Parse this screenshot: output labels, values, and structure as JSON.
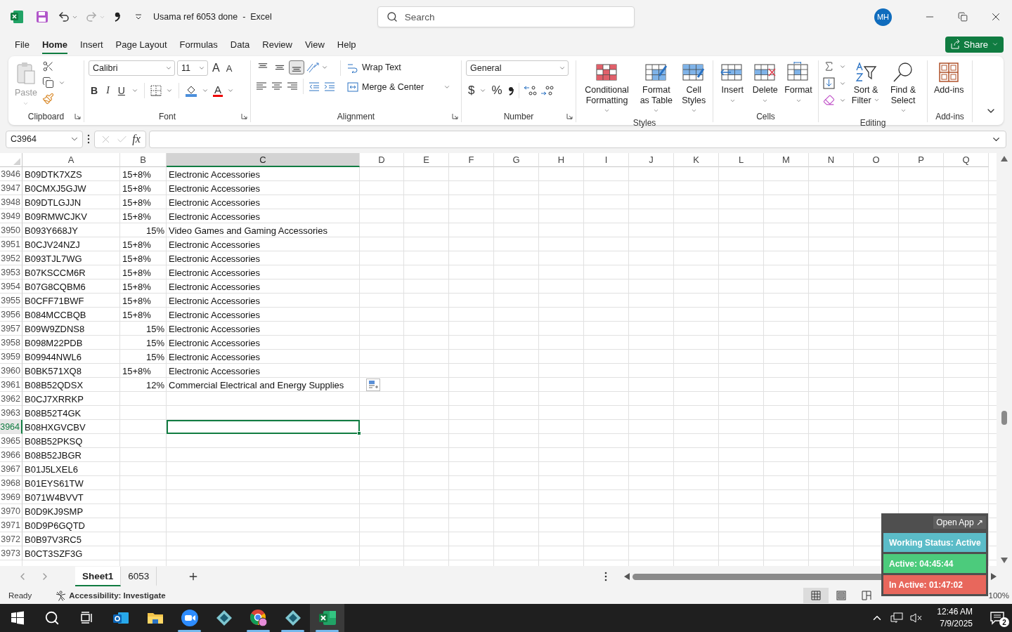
{
  "title_bar": {
    "document_title": "Usama ref 6053 done  -  Excel",
    "redo_disabled": true,
    "search_placeholder": "Search",
    "avatar": "MH"
  },
  "menu": {
    "tabs": [
      {
        "label": "File",
        "selected": false
      },
      {
        "label": "Home",
        "selected": true
      },
      {
        "label": "Insert",
        "selected": false
      },
      {
        "label": "Page Layout",
        "selected": false
      },
      {
        "label": "Formulas",
        "selected": false
      },
      {
        "label": "Data",
        "selected": false
      },
      {
        "label": "Review",
        "selected": false
      },
      {
        "label": "View",
        "selected": false
      },
      {
        "label": "Help",
        "selected": false
      }
    ],
    "share": "Share"
  },
  "ribbon": {
    "clipboard": {
      "label": "Clipboard",
      "paste": "Paste",
      "paste_disabled": true
    },
    "font": {
      "label": "Font",
      "name": "Calibri",
      "size": "11",
      "grow_button": "A",
      "shrink_button": "A",
      "bold": "B",
      "italic": "I",
      "underline": "U",
      "text_paint_button": "A"
    },
    "alignment": {
      "label": "Alignment",
      "vertical": [
        {
          "kind": "top",
          "selected": false
        },
        {
          "kind": "middle",
          "selected": false
        },
        {
          "kind": "bottom",
          "selected": true
        }
      ],
      "wrap": "Wrap Text",
      "merge": "Merge & Center"
    },
    "number": {
      "label": "Number",
      "format": "General",
      "currency": "$",
      "percent": "%"
    },
    "styles": {
      "label": "Styles",
      "buttons": [
        {
          "kind": "conditional",
          "label": "Conditional Formatting"
        },
        {
          "kind": "table",
          "label": "Format as Table"
        },
        {
          "kind": "cell",
          "label": "Cell Styles"
        }
      ]
    },
    "cells": {
      "label": "Cells",
      "buttons": [
        {
          "kind": "insert",
          "label": "Insert"
        },
        {
          "kind": "delete",
          "label": "Delete"
        },
        {
          "kind": "format",
          "label": "Format"
        }
      ]
    },
    "editing": {
      "label": "Editing",
      "sort": "Sort & Filter",
      "find": "Find & Select"
    },
    "addins": {
      "label": "Add-ins",
      "button": "Add-ins"
    }
  },
  "formula_bar": {
    "name_box": "C3964",
    "editing": false,
    "function_button": "fx"
  },
  "columns": [
    {
      "label": "A",
      "selected": false
    },
    {
      "label": "B",
      "selected": false
    },
    {
      "label": "C",
      "selected": true
    },
    {
      "label": "D",
      "selected": false
    },
    {
      "label": "E",
      "selected": false
    },
    {
      "label": "F",
      "selected": false
    },
    {
      "label": "G",
      "selected": false
    },
    {
      "label": "H",
      "selected": false
    },
    {
      "label": "I",
      "selected": false
    },
    {
      "label": "J",
      "selected": false
    },
    {
      "label": "K",
      "selected": false
    },
    {
      "label": "L",
      "selected": false
    },
    {
      "label": "M",
      "selected": false
    },
    {
      "label": "N",
      "selected": false
    },
    {
      "label": "O",
      "selected": false
    },
    {
      "label": "P",
      "selected": false
    },
    {
      "label": "Q",
      "selected": false
    }
  ],
  "rows": [
    {
      "number": "3946",
      "selected": false,
      "cells": [
        {
          "value": "B09DTK7XZS",
          "kind": "text"
        },
        {
          "value": "15+8%",
          "kind": "text"
        },
        {
          "value": "Electronic Accessories",
          "kind": "text"
        }
      ]
    },
    {
      "number": "3947",
      "selected": false,
      "cells": [
        {
          "value": "B0CMXJ5GJW",
          "kind": "text"
        },
        {
          "value": "15+8%",
          "kind": "text"
        },
        {
          "value": "Electronic Accessories",
          "kind": "text"
        }
      ]
    },
    {
      "number": "3948",
      "selected": false,
      "cells": [
        {
          "value": "B09DTLGJJN",
          "kind": "text"
        },
        {
          "value": "15+8%",
          "kind": "text"
        },
        {
          "value": "Electronic Accessories",
          "kind": "text"
        }
      ]
    },
    {
      "number": "3949",
      "selected": false,
      "cells": [
        {
          "value": "B09RMWCJKV",
          "kind": "text"
        },
        {
          "value": "15+8%",
          "kind": "text"
        },
        {
          "value": "Electronic Accessories",
          "kind": "text"
        }
      ]
    },
    {
      "number": "3950",
      "selected": false,
      "cells": [
        {
          "value": "B093Y668JY",
          "kind": "text"
        },
        {
          "value": "15%",
          "kind": "number"
        },
        {
          "value": "Video Games and Gaming Accessories",
          "kind": "text"
        }
      ]
    },
    {
      "number": "3951",
      "selected": false,
      "cells": [
        {
          "value": "B0CJV24NZJ",
          "kind": "text"
        },
        {
          "value": "15+8%",
          "kind": "text"
        },
        {
          "value": "Electronic Accessories",
          "kind": "text"
        }
      ]
    },
    {
      "number": "3952",
      "selected": false,
      "cells": [
        {
          "value": "B093TJL7WG",
          "kind": "text"
        },
        {
          "value": "15+8%",
          "kind": "text"
        },
        {
          "value": "Electronic Accessories",
          "kind": "text"
        }
      ]
    },
    {
      "number": "3953",
      "selected": false,
      "cells": [
        {
          "value": "B07KSCCM6R",
          "kind": "text"
        },
        {
          "value": "15+8%",
          "kind": "text"
        },
        {
          "value": "Electronic Accessories",
          "kind": "text"
        }
      ]
    },
    {
      "number": "3954",
      "selected": false,
      "cells": [
        {
          "value": "B07G8CQBM6",
          "kind": "text"
        },
        {
          "value": "15+8%",
          "kind": "text"
        },
        {
          "value": "Electronic Accessories",
          "kind": "text"
        }
      ]
    },
    {
      "number": "3955",
      "selected": false,
      "cells": [
        {
          "value": "B0CFF71BWF",
          "kind": "text"
        },
        {
          "value": "15+8%",
          "kind": "text"
        },
        {
          "value": "Electronic Accessories",
          "kind": "text"
        }
      ]
    },
    {
      "number": "3956",
      "selected": false,
      "cells": [
        {
          "value": "B084MCCBQB",
          "kind": "text"
        },
        {
          "value": "15+8%",
          "kind": "text"
        },
        {
          "value": "Electronic Accessories",
          "kind": "text"
        }
      ]
    },
    {
      "number": "3957",
      "selected": false,
      "cells": [
        {
          "value": "B09W9ZDNS8",
          "kind": "text"
        },
        {
          "value": "15%",
          "kind": "number"
        },
        {
          "value": "Electronic Accessories",
          "kind": "text"
        }
      ]
    },
    {
      "number": "3958",
      "selected": false,
      "cells": [
        {
          "value": "B098M22PDB",
          "kind": "text"
        },
        {
          "value": "15%",
          "kind": "number"
        },
        {
          "value": "Electronic Accessories",
          "kind": "text"
        }
      ]
    },
    {
      "number": "3959",
      "selected": false,
      "cells": [
        {
          "value": "B09944NWL6",
          "kind": "text"
        },
        {
          "value": "15%",
          "kind": "number"
        },
        {
          "value": "Electronic Accessories",
          "kind": "text"
        }
      ]
    },
    {
      "number": "3960",
      "selected": false,
      "cells": [
        {
          "value": "B0BK571XQ8",
          "kind": "text"
        },
        {
          "value": "15+8%",
          "kind": "text"
        },
        {
          "value": "Electronic Accessories",
          "kind": "text"
        }
      ]
    },
    {
      "number": "3961",
      "selected": false,
      "paste_options": true,
      "cells": [
        {
          "value": "B08B52QDSX",
          "kind": "text"
        },
        {
          "value": "12%",
          "kind": "number"
        },
        {
          "value": "Commercial Electrical and Energy Supplies",
          "kind": "text"
        }
      ]
    },
    {
      "number": "3962",
      "selected": false,
      "cells": [
        {
          "value": "B0CJ7XRRKP",
          "kind": "text"
        }
      ]
    },
    {
      "number": "3963",
      "selected": false,
      "cells": [
        {
          "value": "B08B52T4GK",
          "kind": "text"
        }
      ]
    },
    {
      "number": "3964",
      "selected": true,
      "cells": [
        {
          "value": "B08HXGVCBV",
          "kind": "text"
        }
      ]
    },
    {
      "number": "3965",
      "selected": false,
      "cells": [
        {
          "value": "B08B52PKSQ",
          "kind": "text"
        }
      ]
    },
    {
      "number": "3966",
      "selected": false,
      "cells": [
        {
          "value": "B08B52JBGR",
          "kind": "text"
        }
      ]
    },
    {
      "number": "3967",
      "selected": false,
      "cells": [
        {
          "value": "B01J5LXEL6",
          "kind": "text"
        }
      ]
    },
    {
      "number": "3968",
      "selected": false,
      "cells": [
        {
          "value": "B01EYS61TW",
          "kind": "text"
        }
      ]
    },
    {
      "number": "3969",
      "selected": false,
      "cells": [
        {
          "value": "B071W4BVVT",
          "kind": "text"
        }
      ]
    },
    {
      "number": "3970",
      "selected": false,
      "cells": [
        {
          "value": "B0D9KJ9SMP",
          "kind": "text"
        }
      ]
    },
    {
      "number": "3971",
      "selected": false,
      "cells": [
        {
          "value": "B0D9P6GQTD",
          "kind": "text"
        }
      ]
    },
    {
      "number": "3972",
      "selected": false,
      "cells": [
        {
          "value": "B0B97V3RC5",
          "kind": "text"
        }
      ]
    },
    {
      "number": "3973",
      "selected": false,
      "cells": [
        {
          "value": "B0CT3SZF3G",
          "kind": "text"
        }
      ]
    }
  ],
  "sheet_tabs": [
    {
      "label": "Sheet1",
      "selected": true
    },
    {
      "label": "6053",
      "selected": false
    }
  ],
  "status_bar": {
    "ready": "Ready",
    "accessibility": "Accessibility: Investigate",
    "views": [
      {
        "kind": "normal",
        "selected": true
      },
      {
        "kind": "page_layout",
        "selected": false
      },
      {
        "kind": "page_break",
        "selected": false
      }
    ],
    "zoom": "100%"
  },
  "tracker_widget": {
    "open_app": "Open App ↗",
    "statuses": [
      {
        "label": "Working Status: Active",
        "color": "#5bbcc8"
      },
      {
        "label": "Active: 04:45:44",
        "color": "#4ccb7c"
      },
      {
        "label": "In Active: 01:47:02",
        "color": "#e8675c"
      }
    ]
  },
  "taskbar": {
    "apps": [
      {
        "kind": "start",
        "running": false,
        "focused": false
      },
      {
        "kind": "search",
        "running": false,
        "focused": false
      },
      {
        "kind": "task_view",
        "running": false,
        "focused": false
      },
      {
        "kind": "mail",
        "running": false,
        "focused": false
      },
      {
        "kind": "folder",
        "running": false,
        "focused": false
      },
      {
        "kind": "video",
        "running": true,
        "focused": false
      },
      {
        "kind": "diamond",
        "running": false,
        "focused": false
      },
      {
        "kind": "browser",
        "running": true,
        "focused": false
      },
      {
        "kind": "diamond",
        "running": true,
        "focused": false
      },
      {
        "kind": "spreadsheet",
        "running": true,
        "focused": true
      }
    ],
    "time": "12:46 AM",
    "date": "7/9/2025",
    "notifications": "2"
  }
}
